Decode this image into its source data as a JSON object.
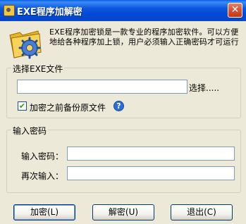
{
  "window": {
    "title": "EXE程序加解密",
    "close_glyph": "✕"
  },
  "description": "EXE程序加密锁是一款专业的程序加密软件。可以方便地给各种程序加上锁，用户必须输入正确密码才可运行",
  "file_group": {
    "title": "选择EXE文件",
    "file_value": "",
    "browse_label": "选择.....",
    "backup_checked": true,
    "backup_label": "加密之前备份原文件",
    "help_glyph": "?"
  },
  "password_group": {
    "title": "输入密码",
    "password_label": "输入密码：",
    "password_value": "",
    "confirm_label": "再次输入：",
    "confirm_value": ""
  },
  "buttons": {
    "encrypt": "加密(L)",
    "decrypt": "解密(U)",
    "exit": "退出(C)"
  },
  "icons": {
    "app": "lock-app-icon",
    "logo": "folder-gear-icon",
    "help": "help-icon",
    "close": "close-icon"
  },
  "colors": {
    "titlebar": "#0049D6",
    "window_bg": "#ECE9D8",
    "close": "#D8502F"
  }
}
